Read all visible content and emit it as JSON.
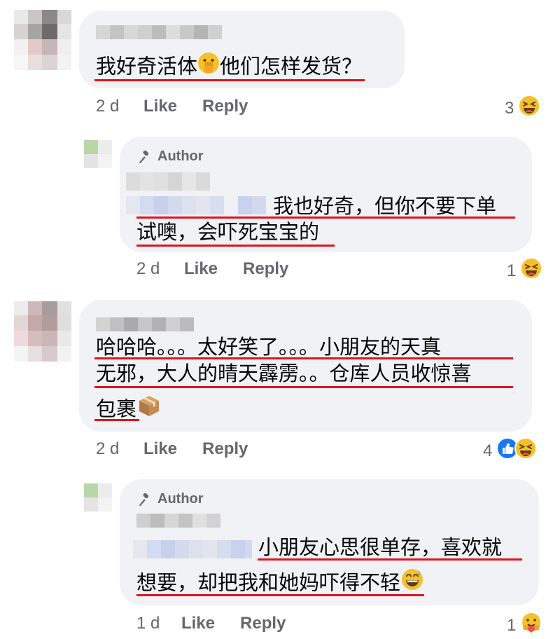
{
  "comments": [
    {
      "text_lines": [
        "我好奇活体",
        "他们怎样发货？"
      ],
      "time": "2 d",
      "like_label": "Like",
      "reply_label": "Reply",
      "reaction_count": "3",
      "reactions": [
        "laughing-face"
      ]
    },
    {
      "author_badge": "Author",
      "text_lines": [
        "我也好奇，但你不要下单",
        "试噢，会吓死宝宝的"
      ],
      "time": "2 d",
      "like_label": "Like",
      "reply_label": "Reply",
      "reaction_count": "1",
      "reactions": [
        "laughing-face"
      ]
    },
    {
      "text_lines": [
        "哈哈哈。。。太好笑了。。。小朋友的天真",
        "无邪，大人的晴天霹雳。。仓库人员收惊喜",
        "包裹"
      ],
      "time": "2 d",
      "like_label": "Like",
      "reply_label": "Reply",
      "reaction_count": "4",
      "reactions": [
        "like-thumb",
        "laughing-face"
      ]
    },
    {
      "author_badge": "Author",
      "text_lines": [
        "小朋友心思很单存，喜欢就",
        "想要，却把我和她妈吓得不轻"
      ],
      "time": "1 d",
      "like_label": "Like",
      "reply_label": "Reply",
      "reaction_count": "1",
      "reactions": [
        "care-hug-face"
      ]
    }
  ],
  "colors": {
    "bubble": "#f0f2f5",
    "meta_text": "#65676b",
    "underline": "#e0141e",
    "like_blue": "#1877f2",
    "emoji_yellow": "#f7c02b"
  }
}
